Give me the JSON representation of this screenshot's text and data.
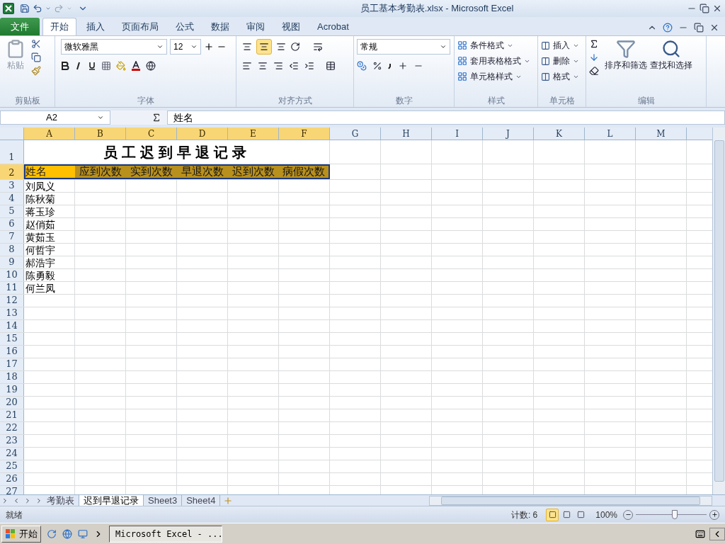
{
  "window": {
    "title": "员工基本考勤表.xlsx - Microsoft Excel"
  },
  "ribbon_tabs": [
    {
      "label": "文件",
      "kind": "file",
      "selected": false
    },
    {
      "label": "开始",
      "kind": "tab",
      "selected": true
    },
    {
      "label": "插入",
      "kind": "tab",
      "selected": false
    },
    {
      "label": "页面布局",
      "kind": "tab",
      "selected": false
    },
    {
      "label": "公式",
      "kind": "tab",
      "selected": false
    },
    {
      "label": "数据",
      "kind": "tab",
      "selected": false
    },
    {
      "label": "审阅",
      "kind": "tab",
      "selected": false
    },
    {
      "label": "视图",
      "kind": "tab",
      "selected": false
    },
    {
      "label": "Acrobat",
      "kind": "tab",
      "selected": false
    }
  ],
  "ribbon": {
    "clipboard": {
      "paste": "粘贴",
      "label": "剪贴板"
    },
    "font": {
      "name": "微软雅黑",
      "size": "12",
      "label": "字体"
    },
    "alignment": {
      "label": "对齐方式",
      "middle_align_on": true
    },
    "number": {
      "format": "常规",
      "label": "数字"
    },
    "styles": {
      "items": [
        "条件格式",
        "套用表格格式",
        "单元格样式"
      ],
      "label": "样式"
    },
    "cells": {
      "items": [
        "插入",
        "删除",
        "格式"
      ],
      "label": "单元格"
    },
    "editing": {
      "buttons": [
        "排序和筛选",
        "查找和选择"
      ],
      "label": "编辑"
    }
  },
  "formula_bar": {
    "name_box": "A2",
    "content": "姓名"
  },
  "columns": [
    {
      "label": "A",
      "selected": true
    },
    {
      "label": "B",
      "selected": true
    },
    {
      "label": "C",
      "selected": true
    },
    {
      "label": "D",
      "selected": true
    },
    {
      "label": "E",
      "selected": true
    },
    {
      "label": "F",
      "selected": true
    },
    {
      "label": "G",
      "selected": false
    },
    {
      "label": "H",
      "selected": false
    },
    {
      "label": "I",
      "selected": false
    },
    {
      "label": "J",
      "selected": false
    },
    {
      "label": "K",
      "selected": false
    },
    {
      "label": "L",
      "selected": false
    },
    {
      "label": "M",
      "selected": false
    }
  ],
  "rows": [
    {
      "number": "1",
      "selected": false,
      "kind": "title",
      "title": "员工迟到早退记录"
    },
    {
      "number": "2",
      "selected": true,
      "kind": "header",
      "cells": [
        {
          "text": "姓名",
          "selected": true,
          "active": true
        },
        {
          "text": "应到次数",
          "selected": true,
          "active": false
        },
        {
          "text": "实到次数",
          "selected": true,
          "active": false
        },
        {
          "text": "早退次数",
          "selected": true,
          "active": false
        },
        {
          "text": "迟到次数",
          "selected": true,
          "active": false
        },
        {
          "text": "病假次数",
          "selected": true,
          "active": false
        }
      ]
    },
    {
      "number": "3",
      "selected": false,
      "kind": "data",
      "name": "刘凤义"
    },
    {
      "number": "4",
      "selected": false,
      "kind": "data",
      "name": "陈秋菊"
    },
    {
      "number": "5",
      "selected": false,
      "kind": "data",
      "name": "蒋玉珍"
    },
    {
      "number": "6",
      "selected": false,
      "kind": "data",
      "name": "赵俏茹"
    },
    {
      "number": "7",
      "selected": false,
      "kind": "data",
      "name": "黄茹玉"
    },
    {
      "number": "8",
      "selected": false,
      "kind": "data",
      "name": "何哲宇"
    },
    {
      "number": "9",
      "selected": false,
      "kind": "data",
      "name": "郝浩宇"
    },
    {
      "number": "10",
      "selected": false,
      "kind": "data",
      "name": "陈勇毅"
    },
    {
      "number": "11",
      "selected": false,
      "kind": "data",
      "name": "何兰凤"
    },
    {
      "number": "12",
      "selected": false,
      "kind": "empty"
    },
    {
      "number": "13",
      "selected": false,
      "kind": "empty"
    },
    {
      "number": "14",
      "selected": false,
      "kind": "empty"
    },
    {
      "number": "15",
      "selected": false,
      "kind": "empty"
    },
    {
      "number": "16",
      "selected": false,
      "kind": "empty"
    },
    {
      "number": "17",
      "selected": false,
      "kind": "empty"
    },
    {
      "number": "18",
      "selected": false,
      "kind": "empty"
    },
    {
      "number": "19",
      "selected": false,
      "kind": "empty"
    },
    {
      "number": "20",
      "selected": false,
      "kind": "empty"
    },
    {
      "number": "21",
      "selected": false,
      "kind": "empty"
    },
    {
      "number": "22",
      "selected": false,
      "kind": "empty"
    },
    {
      "number": "23",
      "selected": false,
      "kind": "empty"
    },
    {
      "number": "24",
      "selected": false,
      "kind": "empty"
    },
    {
      "number": "25",
      "selected": false,
      "kind": "empty"
    },
    {
      "number": "26",
      "selected": false,
      "kind": "empty"
    },
    {
      "number": "27",
      "selected": false,
      "kind": "empty"
    }
  ],
  "sheet_tabs": [
    {
      "label": "考勤表",
      "selected": false
    },
    {
      "label": "迟到早退记录",
      "selected": true
    },
    {
      "label": "Sheet3",
      "selected": false
    },
    {
      "label": "Sheet4",
      "selected": false
    }
  ],
  "status_bar": {
    "status": "就绪",
    "count": "计数: 6",
    "views": [
      {
        "selected": true
      },
      {
        "selected": false
      },
      {
        "selected": false
      }
    ],
    "zoom": "100%",
    "zoom_slider": {
      "level": 0.55
    }
  },
  "taskbar": {
    "start": "开始",
    "task": "Microsoft Excel - ..."
  }
}
